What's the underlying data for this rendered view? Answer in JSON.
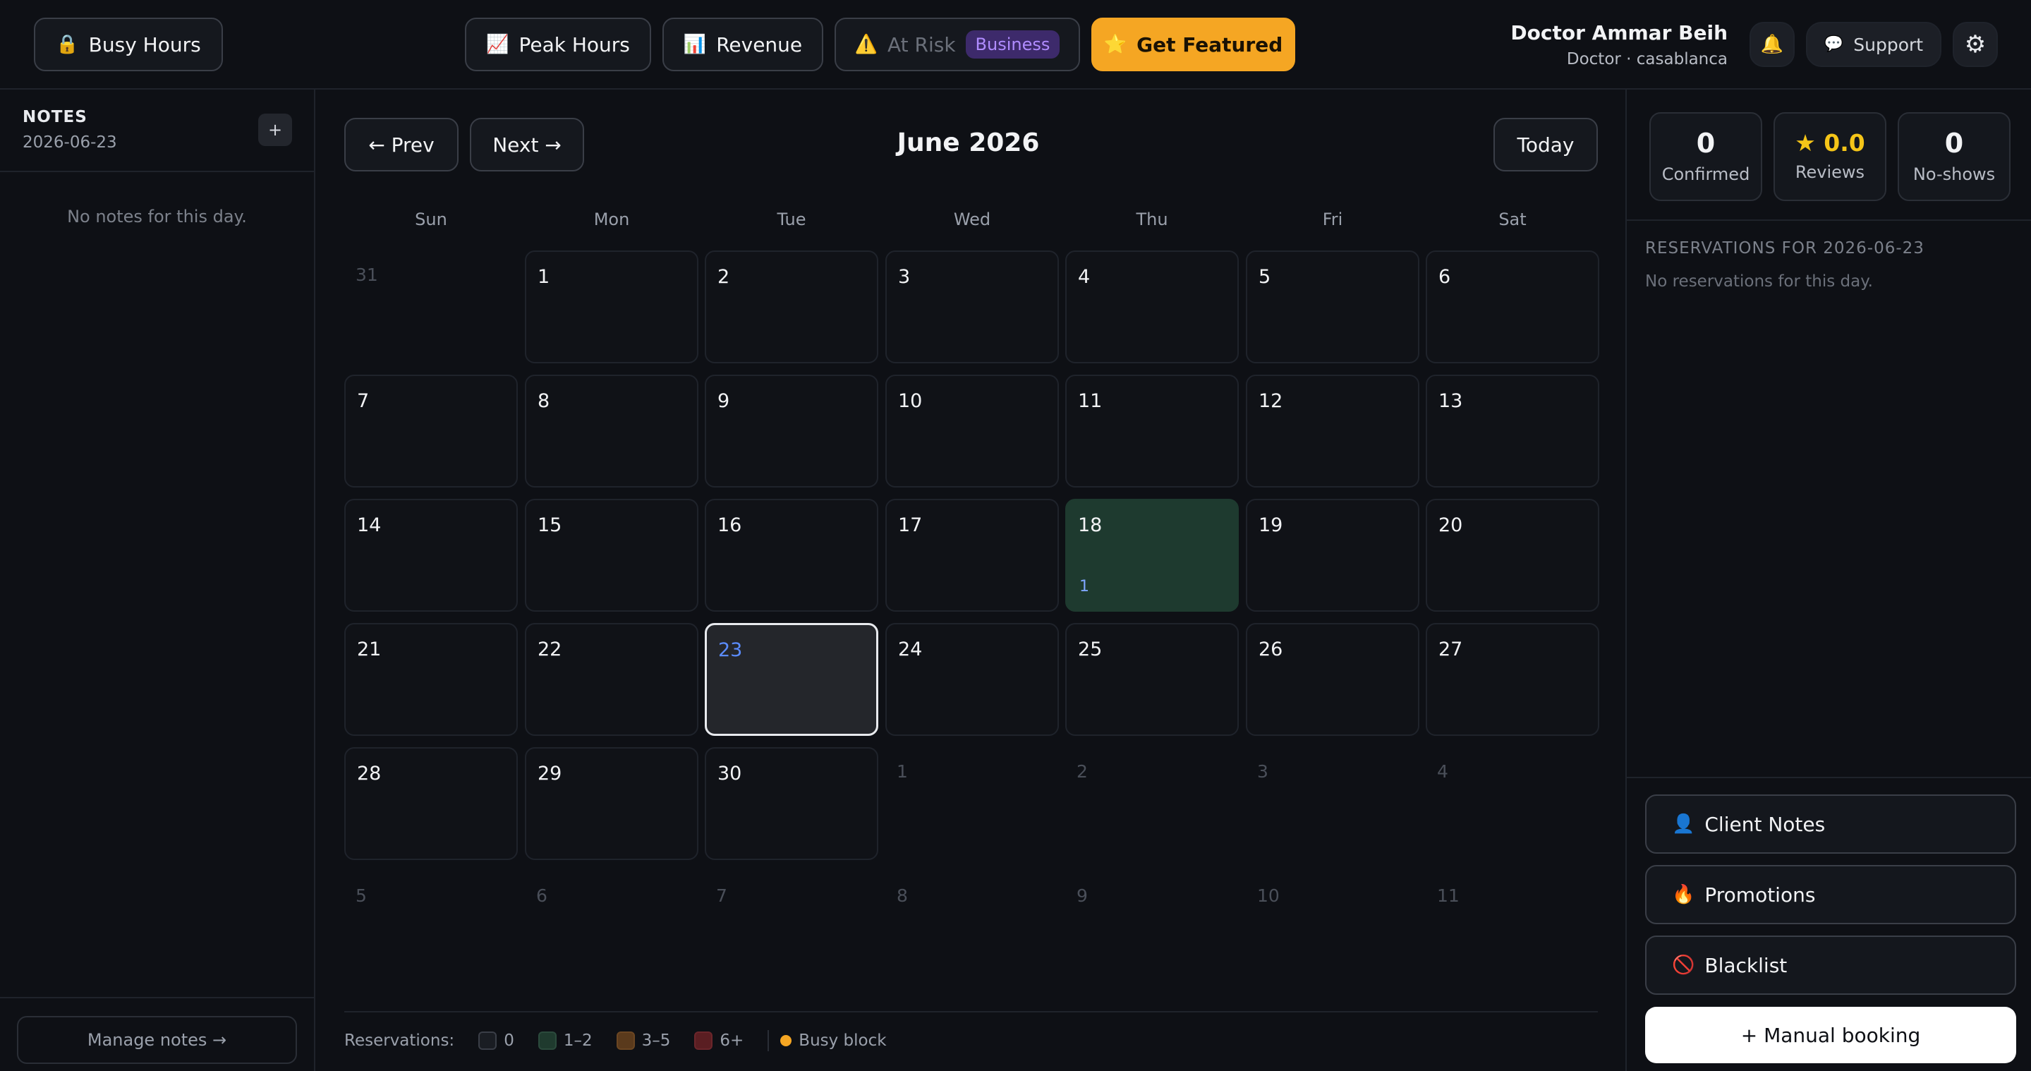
{
  "topbar": {
    "busy_hours": {
      "icon": "lock-icon",
      "glyph": "🔒",
      "label": "Busy Hours"
    },
    "peak_hours": {
      "icon": "chart-up-icon",
      "glyph": "📈",
      "label": "Peak Hours"
    },
    "revenue": {
      "icon": "bar-chart-icon",
      "glyph": "📊",
      "label": "Revenue"
    },
    "at_risk": {
      "icon": "warning-icon",
      "glyph": "⚠️",
      "label": "At Risk",
      "badge": "Business"
    },
    "get_featured": {
      "icon": "star-icon",
      "glyph": "⭐",
      "label": "Get Featured"
    },
    "user": {
      "name": "Doctor Ammar Beih",
      "subtitle": "Doctor · casablanca"
    },
    "bell": {
      "icon": "bell-icon",
      "glyph": "🔔"
    },
    "support": {
      "icon": "speech-bubble-icon",
      "glyph": "💬",
      "label": "Support"
    },
    "settings": {
      "icon": "gear-icon",
      "glyph": "⚙"
    }
  },
  "notes": {
    "title": "NOTES",
    "date": "2026-06-23",
    "add_glyph": "+",
    "empty": "No notes for this day.",
    "manage": "Manage notes →"
  },
  "calendar": {
    "prev": "← Prev",
    "next": "Next →",
    "title": "June 2026",
    "today": "Today",
    "weekdays": [
      "Sun",
      "Mon",
      "Tue",
      "Wed",
      "Thu",
      "Fri",
      "Sat"
    ],
    "weeks": [
      [
        {
          "d": "31",
          "out": true
        },
        {
          "d": "1"
        },
        {
          "d": "2"
        },
        {
          "d": "3"
        },
        {
          "d": "4"
        },
        {
          "d": "5"
        },
        {
          "d": "6"
        }
      ],
      [
        {
          "d": "7"
        },
        {
          "d": "8"
        },
        {
          "d": "9"
        },
        {
          "d": "10"
        },
        {
          "d": "11"
        },
        {
          "d": "12"
        },
        {
          "d": "13"
        }
      ],
      [
        {
          "d": "14"
        },
        {
          "d": "15"
        },
        {
          "d": "16"
        },
        {
          "d": "17"
        },
        {
          "d": "18",
          "count": "1"
        },
        {
          "d": "19"
        },
        {
          "d": "20"
        }
      ],
      [
        {
          "d": "21"
        },
        {
          "d": "22"
        },
        {
          "d": "23",
          "selected": true
        },
        {
          "d": "24"
        },
        {
          "d": "25"
        },
        {
          "d": "26"
        },
        {
          "d": "27"
        }
      ],
      [
        {
          "d": "28"
        },
        {
          "d": "29"
        },
        {
          "d": "30"
        },
        {
          "d": "1",
          "out": true
        },
        {
          "d": "2",
          "out": true
        },
        {
          "d": "3",
          "out": true
        },
        {
          "d": "4",
          "out": true
        }
      ],
      [
        {
          "d": "5",
          "out": true
        },
        {
          "d": "6",
          "out": true
        },
        {
          "d": "7",
          "out": true
        },
        {
          "d": "8",
          "out": true
        },
        {
          "d": "9",
          "out": true
        },
        {
          "d": "10",
          "out": true
        },
        {
          "d": "11",
          "out": true
        }
      ]
    ],
    "legend": {
      "label": "Reservations:",
      "items": [
        {
          "label": "0",
          "color": "#1a1d23"
        },
        {
          "label": "1–2",
          "color": "#1f3a2e"
        },
        {
          "label": "3–5",
          "color": "#5a3a1c"
        },
        {
          "label": "6+",
          "color": "#5a1e22"
        }
      ],
      "busy": "Busy block",
      "busy_color": "#f5a623"
    }
  },
  "stats": {
    "confirmed": {
      "value": "0",
      "label": "Confirmed"
    },
    "reviews": {
      "value": "★ 0.0",
      "label": "Reviews"
    },
    "noshows": {
      "value": "0",
      "label": "No-shows"
    }
  },
  "reservations": {
    "title": "RESERVATIONS FOR 2026-06-23",
    "empty": "No reservations for this day."
  },
  "actions": {
    "client_notes": {
      "icon": "user-icon",
      "glyph": "👤",
      "label": "Client Notes"
    },
    "promotions": {
      "icon": "fire-icon",
      "glyph": "🔥",
      "label": "Promotions"
    },
    "blacklist": {
      "icon": "prohibited-icon",
      "glyph": "🚫",
      "label": "Blacklist"
    },
    "manual_booking": "+ Manual booking"
  },
  "colors": {
    "accent": "#f5a623",
    "selected_day": "#5b8cff",
    "reserved_cell": "#1e3a2f",
    "badge_bg": "#3d2a6b",
    "badge_text": "#b08cff"
  }
}
